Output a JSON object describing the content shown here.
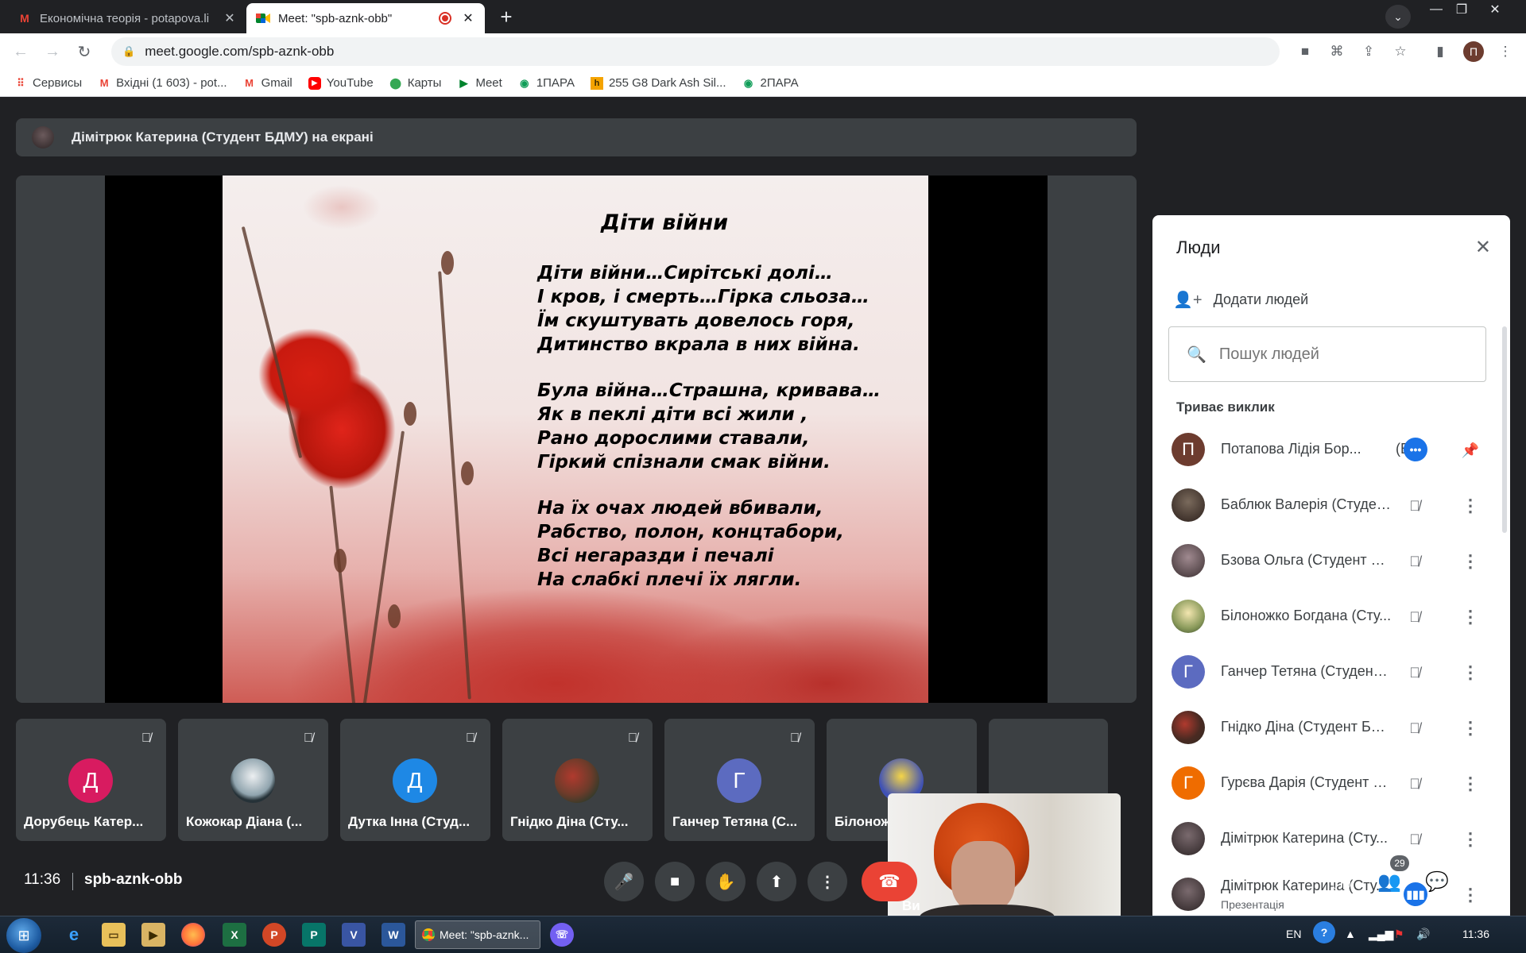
{
  "browser": {
    "tabs": [
      {
        "title": "Економічна теорія - potapova.li",
        "favicon": "gmail-icon"
      },
      {
        "title": "Meet: \"spb-aznk-obb\"",
        "favicon": "meet-icon",
        "recording": true
      }
    ],
    "url": "meet.google.com/spb-aznk-obb",
    "profile_initial": "П",
    "bookmarks": [
      {
        "label": "Сервисы",
        "icon": "apps-icon"
      },
      {
        "label": "Вхідні (1 603) - pot...",
        "icon": "gmail-icon"
      },
      {
        "label": "Gmail",
        "icon": "gmail-icon"
      },
      {
        "label": "YouTube",
        "icon": "youtube-icon"
      },
      {
        "label": "Карты",
        "icon": "maps-icon"
      },
      {
        "label": "Meet",
        "icon": "meet-icon"
      },
      {
        "label": "1ПАРА",
        "icon": "meet-pin-icon"
      },
      {
        "label": "255 G8 Dark Ash Sil...",
        "icon": "hp-icon"
      },
      {
        "label": "2ПАРА",
        "icon": "meet-pin-icon"
      }
    ]
  },
  "meet": {
    "presenter_label": "Дімітрюк Катерина (Студент БДМУ) на екрані",
    "slide": {
      "title": "Діти війни",
      "stanzas": [
        [
          "Діти війни…Сирітські долі…",
          "І кров, і смерть…Гірка сльоза…",
          "Їм скуштувать довелось горя,",
          "Дитинство вкрала в них війна."
        ],
        [
          "Була війна…Страшна, кривава…",
          "Як в пеклі діти всі жили ,",
          "Рано дорослими ставали,",
          "Гіркий спізнали смак війни."
        ],
        [
          "На їх очах людей вбивали,",
          "Рабство, полон, концтабори,",
          "Всі негаразди і печалі",
          "На слабкі плечі їх лягли."
        ]
      ]
    },
    "tiles": [
      {
        "name": "Дорубець Катер...",
        "initial": "Д",
        "color": "#d81b60"
      },
      {
        "name": "Кожокар Діана (...",
        "initial": "",
        "color": "#cfd8dc"
      },
      {
        "name": "Дутка Інна (Студ...",
        "initial": "Д",
        "color": "#1e88e5"
      },
      {
        "name": "Гнідко Діна (Сту...",
        "initial": "",
        "color": "#6d3b2a"
      },
      {
        "name": "Ганчер Тетяна (С...",
        "initial": "Г",
        "color": "#5c6bc0"
      },
      {
        "name": "Білонож...",
        "initial": "",
        "color": "#3f51b5"
      }
    ],
    "self_label": "Ви",
    "time": "11:36",
    "meeting_code": "spb-aznk-obb",
    "participant_count": "29",
    "accent_end_call": "#ea4335"
  },
  "people_panel": {
    "title": "Люди",
    "add_people": "Додати людей",
    "search_placeholder": "Пошук людей",
    "section": "Триває виклик",
    "you_suffix": "(Ви)",
    "participants": [
      {
        "name": "Потапова Лідія Бор...",
        "initial": "П",
        "color": "#6d3c2f",
        "state": "you"
      },
      {
        "name": "Баблюк Валерія (Студен...",
        "initial": "",
        "color": "#3b2a26",
        "state": "muted"
      },
      {
        "name": "Бзова Ольга (Студент Б...",
        "initial": "",
        "color": "#5d4a4e",
        "state": "muted"
      },
      {
        "name": "Білоножко Богдана (Сту...",
        "initial": "",
        "color": "#8a9a5b",
        "state": "muted"
      },
      {
        "name": "Ганчер Тетяна (Студент ...",
        "initial": "Г",
        "color": "#5c6bc0",
        "state": "muted"
      },
      {
        "name": "Гнідко Діна (Студент БД...",
        "initial": "",
        "color": "#4a2a22",
        "state": "muted"
      },
      {
        "name": "Гурєва Дарія (Студент Б...",
        "initial": "Г",
        "color": "#ef6c00",
        "state": "muted"
      },
      {
        "name": "Дімітрюк Катерина (Сту...",
        "initial": "",
        "color": "#4e4347",
        "state": "muted"
      },
      {
        "name": "Дімітрюк Катерина (Сту...",
        "initial": "",
        "color": "#4e4347",
        "state": "presenting",
        "sub": "Презентація"
      }
    ]
  },
  "taskbar": {
    "window_label": "Meet: \"spb-aznk...",
    "lang": "EN",
    "clock": "11:36"
  }
}
